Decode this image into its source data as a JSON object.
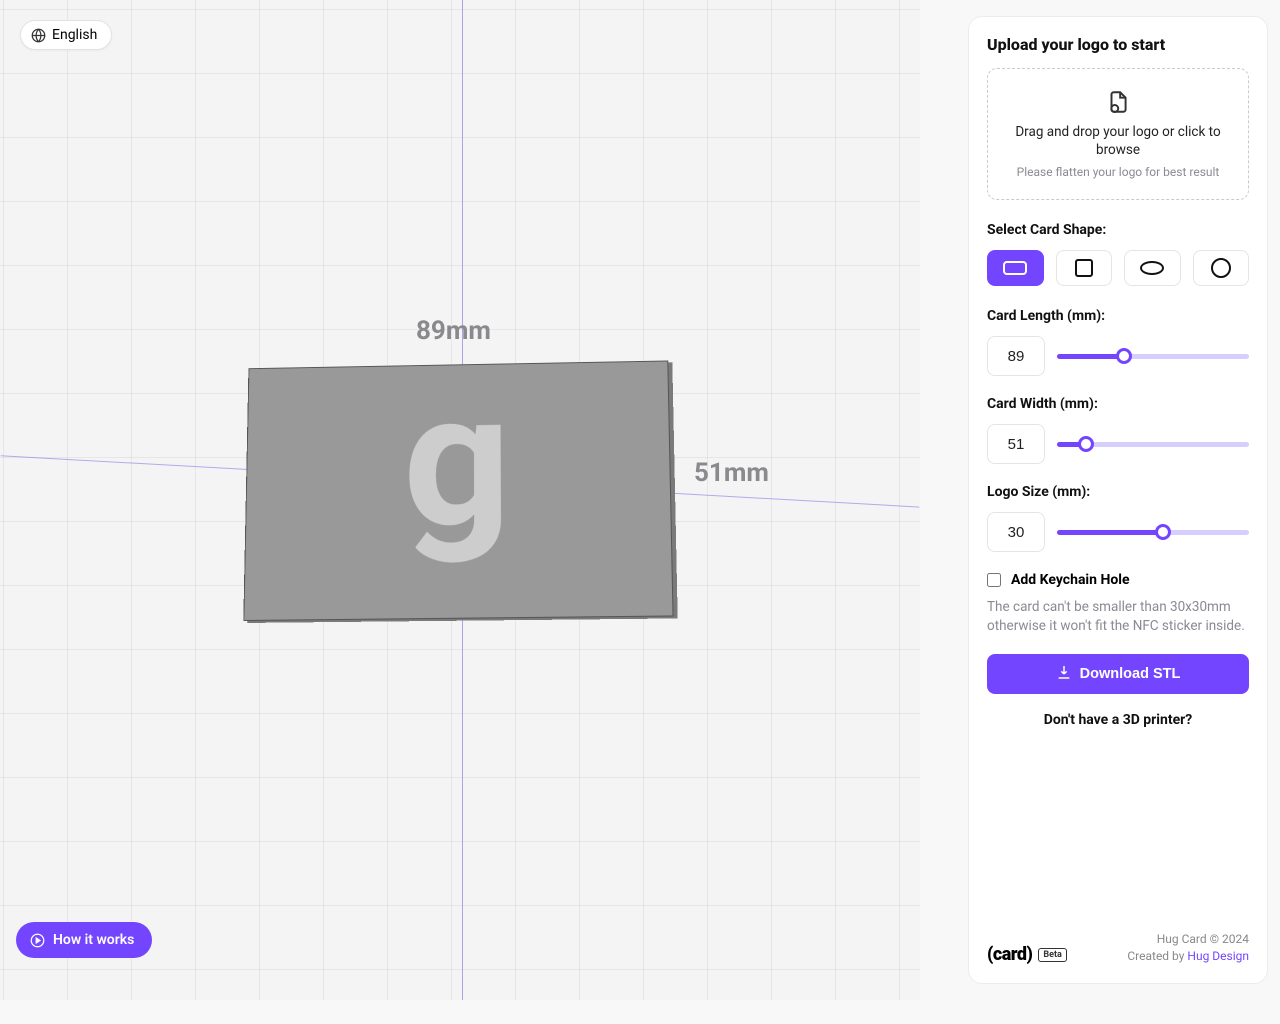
{
  "language": {
    "label": "English"
  },
  "how_it_works": "How it works",
  "canvas": {
    "length_dim": "89mm",
    "width_dim": "51mm",
    "letter": "g"
  },
  "sidebar": {
    "title": "Upload your logo to start",
    "dropzone": {
      "main": "Drag and drop your logo or click to browse",
      "sub": "Please flatten your logo for best result"
    },
    "shape_label": "Select Card Shape:",
    "length": {
      "label": "Card Length (mm):",
      "value": "89"
    },
    "width": {
      "label": "Card Width (mm):",
      "value": "51"
    },
    "logo_size": {
      "label": "Logo Size (mm):",
      "value": "30"
    },
    "keychain_label": "Add Keychain Hole",
    "note": "The card can't be smaller than 30x30mm otherwise it won't fit the NFC sticker inside.",
    "download_label": "Download STL",
    "no_printer": "Don't have a 3D printer?"
  },
  "footer": {
    "logo_text": "(card)",
    "beta": "Beta",
    "copyright": "Hug Card © 2024",
    "created_prefix": "Created by ",
    "created_link": "Hug Design"
  },
  "sliders": {
    "length_pct": 35,
    "width_pct": 15,
    "logo_pct": 55
  }
}
